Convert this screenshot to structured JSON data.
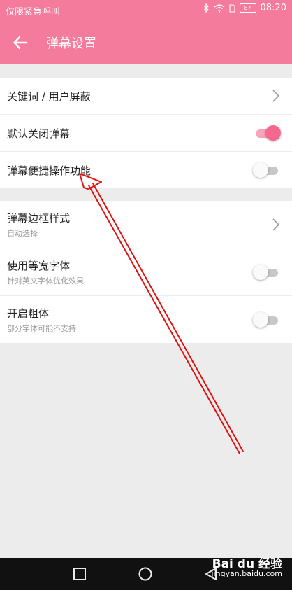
{
  "status_bar": {
    "carrier_text": "仅限紧急呼叫",
    "battery": "87",
    "time": "08:20",
    "icons": [
      "bluetooth-icon",
      "wifi-icon",
      "sim-icon",
      "battery-icon"
    ]
  },
  "app_bar": {
    "title": "弹幕设置",
    "back_icon": "arrow-left-icon",
    "color": "#f47b9c"
  },
  "group1": [
    {
      "label": "关键词 / 用户屏蔽",
      "control": "chevron"
    },
    {
      "label": "默认关闭弹幕",
      "control": "toggle",
      "on": true
    },
    {
      "label": "弹幕便捷操作功能",
      "control": "toggle",
      "on": false
    }
  ],
  "group2": [
    {
      "label": "弹幕边框样式",
      "sub": "自动选择",
      "control": "chevron"
    },
    {
      "label": "使用等宽字体",
      "sub": "针对英文字体优化效果",
      "control": "toggle",
      "on": false
    },
    {
      "label": "开启粗体",
      "sub": "部分字体可能不支持",
      "control": "toggle",
      "on": false
    }
  ],
  "nav_bar": {
    "buttons": [
      "recents-square-icon",
      "home-circle-icon",
      "back-triangle-icon"
    ]
  },
  "watermark": {
    "main": "Bai du 经验",
    "sub": "jingyan.baidu.com"
  },
  "annotation_color": "#e01010"
}
